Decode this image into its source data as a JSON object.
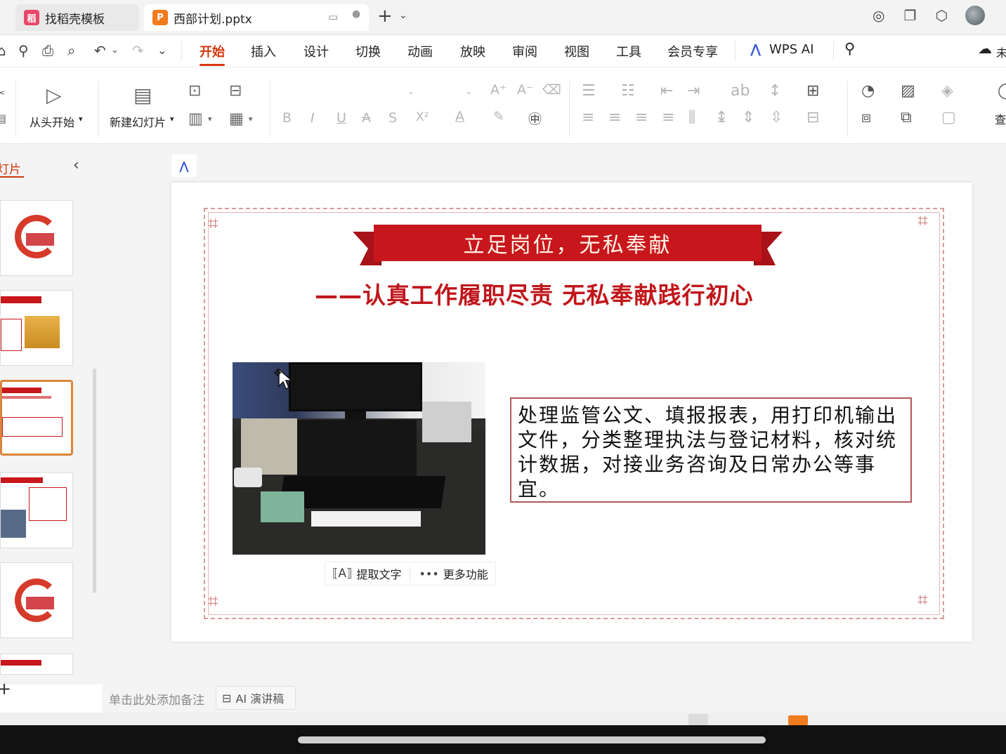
{
  "tabs": [
    {
      "label": "找稻壳模板",
      "icon": "docer-icon",
      "color": "#e8476a"
    },
    {
      "label": "西部计划.pptx",
      "icon": "ppt-file-icon",
      "color": "#f07c1e"
    }
  ],
  "menu": {
    "items": [
      "开始",
      "插入",
      "设计",
      "切换",
      "动画",
      "放映",
      "审阅",
      "视图",
      "工具",
      "会员专享",
      "WPS AI"
    ],
    "active": "开始"
  },
  "ribbon": {
    "start_from_beginning": "从头开始",
    "new_slide": "新建幻灯片",
    "font_glyphs": {
      "bold": "B",
      "italic": "I",
      "underline": "U",
      "strike": "A",
      "shadow": "S",
      "superscript": "X²",
      "font_color": "A"
    },
    "partial_right_label": "查"
  },
  "panel": {
    "title": "幻灯片",
    "title_visible": "灯片"
  },
  "slide": {
    "banner_title": "立足岗位，无私奉献",
    "subtitle": "——认真工作履职尽责 无私奉献践行初心",
    "body_text": "处理监管公文、填报报表，用打印机输出文件，分类整理执法与登记材料，核对统计数据，对接业务咨询及日常办公等事宜。"
  },
  "photo_tools": {
    "extract_text": "提取文字",
    "more_features": "更多功能"
  },
  "notes": {
    "placeholder": "单击此处添加备注",
    "ai_button": "AI 演讲稿"
  },
  "colors": {
    "accent": "#d4380d",
    "banner_red": "#c8161d",
    "frame": "#d79a9a"
  }
}
